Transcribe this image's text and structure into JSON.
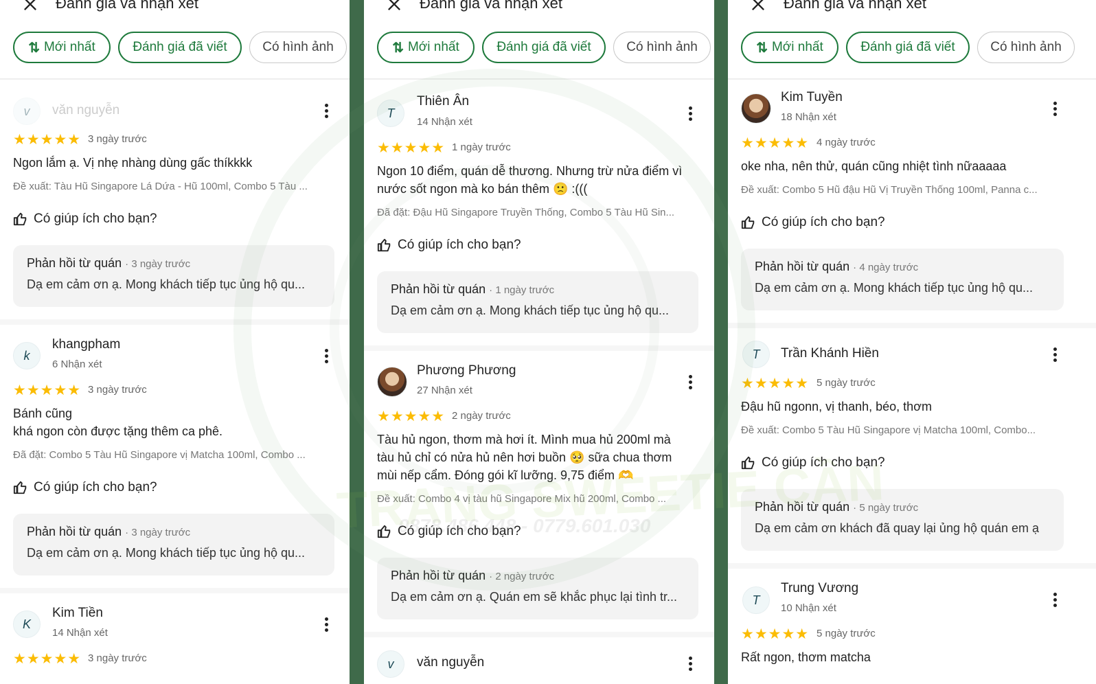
{
  "header": {
    "title": "Đánh giá và nhận xét"
  },
  "chips": {
    "newest": "Mới nhất",
    "written": "Đánh giá đã viết",
    "photos": "Có hình ảnh"
  },
  "helpful_label": "Có giúp ích cho bạn?",
  "reply_title": "Phản hồi từ quán",
  "stars": "★★★★★",
  "colors": {
    "accent": "#1e7a3c",
    "star": "#fbbc04",
    "divider": "#3f6a4a"
  },
  "watermark": {
    "text": "TRANG SWEETIE CẦN",
    "phone": "0878.486.448 - 0779.601.030"
  },
  "panel1": {
    "r1": {
      "initial": "v",
      "name": "văn nguyễn",
      "date": "3 ngày trước",
      "text": "Ngon lắm ạ. Vị nhẹ nhàng dùng gấc thíkkkk",
      "order": "Đề xuất: Tàu Hũ Singapore Lá Dứa - Hũ 100ml, Combo 5 Tàu ...",
      "reply_date": "· 3 ngày trước",
      "reply_text": "Dạ em cảm ơn ạ. Mong khách tiếp tục ủng hộ qu..."
    },
    "r2": {
      "initial": "k",
      "name": "khangpham",
      "count": "6 Nhận xét",
      "date": "3 ngày trước",
      "text": "Bánh cũng\n khá ngon còn được tặng thêm ca phê.",
      "order": "Đã đặt: Combo 5 Tàu Hũ Singapore vị Matcha 100ml, Combo ...",
      "reply_date": "· 3 ngày trước",
      "reply_text": "Dạ em cảm ơn ạ. Mong khách tiếp tục ủng hộ qu..."
    },
    "r3": {
      "initial": "K",
      "name": "Kim Tiền",
      "count": "14 Nhận xét",
      "date": "3 ngày trước"
    }
  },
  "panel2": {
    "r1": {
      "initial": "T",
      "name": "Thiên Ân",
      "count": "14 Nhận xét",
      "date": "1 ngày trước",
      "text": "Ngon 10 điểm, quán dễ thương. Nhưng trừ nửa điểm vì\nnước sốt ngon mà ko bán thêm 🙁  :(((",
      "order": "Đã đặt: Đậu Hũ Singapore Truyền Thống, Combo 5 Tàu Hũ Sin...",
      "reply_date": "· 1 ngày trước",
      "reply_text": "Dạ em cảm ơn ạ. Mong khách tiếp tục ủng hộ qu..."
    },
    "r2": {
      "name": "Phương Phương",
      "count": "27 Nhận xét",
      "date": "2 ngày trước",
      "text": "Tàu hủ ngon, thơm mà hơi ít. Mình mua hủ 200ml mà\ntàu hủ chỉ có nửa hủ nên hơi buồn 🥺 sữa chua thơm\nmùi nếp cẩm. Đóng gói kĩ lưỡng. 9,75 điểm 🫶",
      "order": "Đề xuất: Combo 4 vị tàu hũ Singapore Mix hũ 200ml, Combo ...",
      "reply_date": "· 2 ngày trước",
      "reply_text": "Dạ em cảm ơn ạ. Quán em sẽ khắc phục lại tình tr..."
    },
    "r3": {
      "initial": "v",
      "name": "văn nguyễn"
    }
  },
  "panel3": {
    "r1": {
      "name": "Kim Tuyền",
      "count": "18 Nhận xét",
      "date": "4 ngày trước",
      "text": "oke nha, nên thử, quán cũng nhiệt tình nữaaaaa",
      "order": "Đề xuất: Combo 5 Hũ đậu Hũ Vị Truyền Thống 100ml, Panna c...",
      "reply_date": "· 4 ngày trước",
      "reply_text": "Dạ em cảm ơn ạ. Mong khách tiếp tục ủng hộ qu..."
    },
    "r2": {
      "initial": "T",
      "name": "Trần Khánh Hiền",
      "date": "5 ngày trước",
      "text": "Đậu hũ ngonn, vị thanh, béo, thơm",
      "order": "Đề xuất: Combo 5 Tàu Hũ Singapore vị Matcha 100ml, Combo...",
      "reply_date": "· 5 ngày trước",
      "reply_text": "Dạ em cảm ơn khách đã quay lại ủng hộ quán em ạ"
    },
    "r3": {
      "initial": "T",
      "name": "Trung Vương",
      "count": "10 Nhận xét",
      "date": "5 ngày trước",
      "text": "Rất ngon, thơm matcha"
    }
  }
}
